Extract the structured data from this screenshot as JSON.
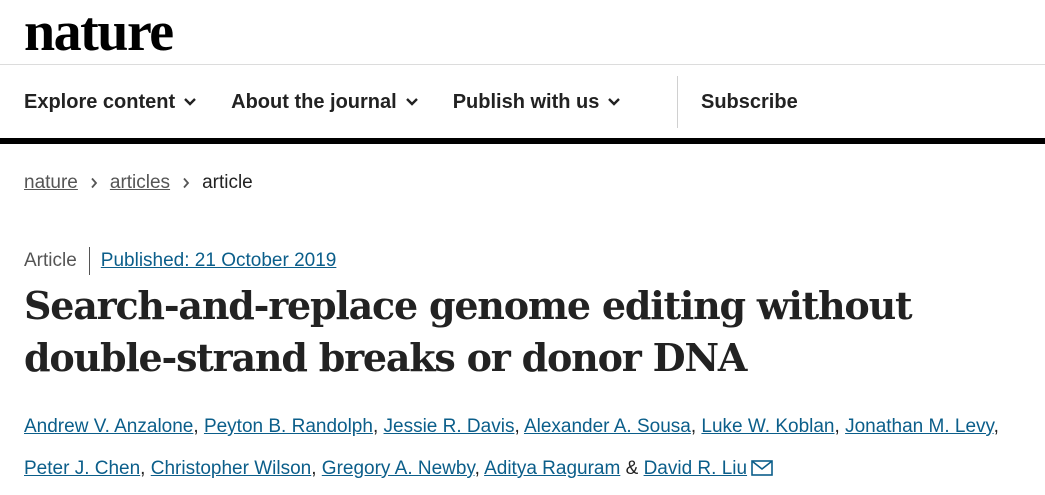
{
  "header": {
    "logo": "nature"
  },
  "nav": {
    "items": [
      {
        "label": "Explore content",
        "has_dropdown": true
      },
      {
        "label": "About the journal",
        "has_dropdown": true
      },
      {
        "label": "Publish with us",
        "has_dropdown": true
      }
    ],
    "subscribe": "Subscribe"
  },
  "breadcrumb": {
    "items": [
      "nature",
      "articles"
    ],
    "current": "article"
  },
  "article": {
    "type": "Article",
    "published": "Published: 21 October 2019",
    "title": "Search-and-replace genome editing without double-strand breaks or donor DNA",
    "authors": [
      "Andrew V. Anzalone",
      "Peyton B. Randolph",
      "Jessie R. Davis",
      "Alexander A. Sousa",
      "Luke W. Koblan",
      "Jonathan M. Levy",
      "Peter J. Chen",
      "Christopher Wilson",
      "Gregory A. Newby",
      "Aditya Raguram",
      "David R. Liu"
    ],
    "ampersand": "&"
  },
  "icons": {
    "nav_dropdown": "chevron-down-icon",
    "breadcrumb_sep": "chevron-right-icon",
    "contact": "mail-icon"
  },
  "colors": {
    "link": "#0b5e8a",
    "thick_bar": "#000000"
  }
}
